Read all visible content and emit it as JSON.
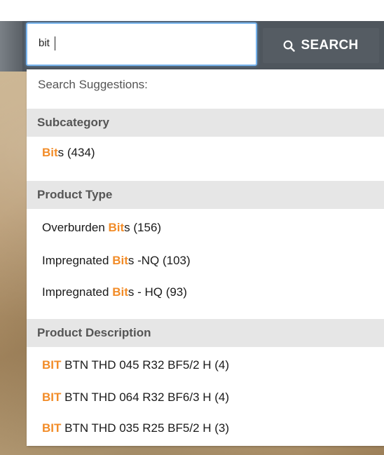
{
  "search": {
    "query": "bit",
    "button_label": "SEARCH",
    "icon": "search-icon"
  },
  "dropdown": {
    "title": "Search Suggestions:",
    "highlight_color": "#f28c28",
    "sections": [
      {
        "header": "Subcategory",
        "items": [
          {
            "match": "Bit",
            "rest": "s (434)"
          }
        ]
      },
      {
        "header": "Product Type",
        "items": [
          {
            "before": "Overburden ",
            "match": "Bit",
            "rest": "s (156)"
          },
          {
            "before": "Impregnated ",
            "match": "Bit",
            "rest": "s -NQ (103)"
          },
          {
            "before": "Impregnated ",
            "match": "Bit",
            "rest": "s - HQ (93)"
          }
        ]
      },
      {
        "header": "Product Description",
        "items": [
          {
            "match": "BIT",
            "rest": " BTN THD 045 R32 BF5/2 H (4)"
          },
          {
            "match": "BIT",
            "rest": " BTN THD 064 R32 BF6/3 H (4)"
          },
          {
            "match": "BIT",
            "rest": " BTN THD 035 R25 BF5/2 H (3)"
          }
        ]
      }
    ]
  }
}
